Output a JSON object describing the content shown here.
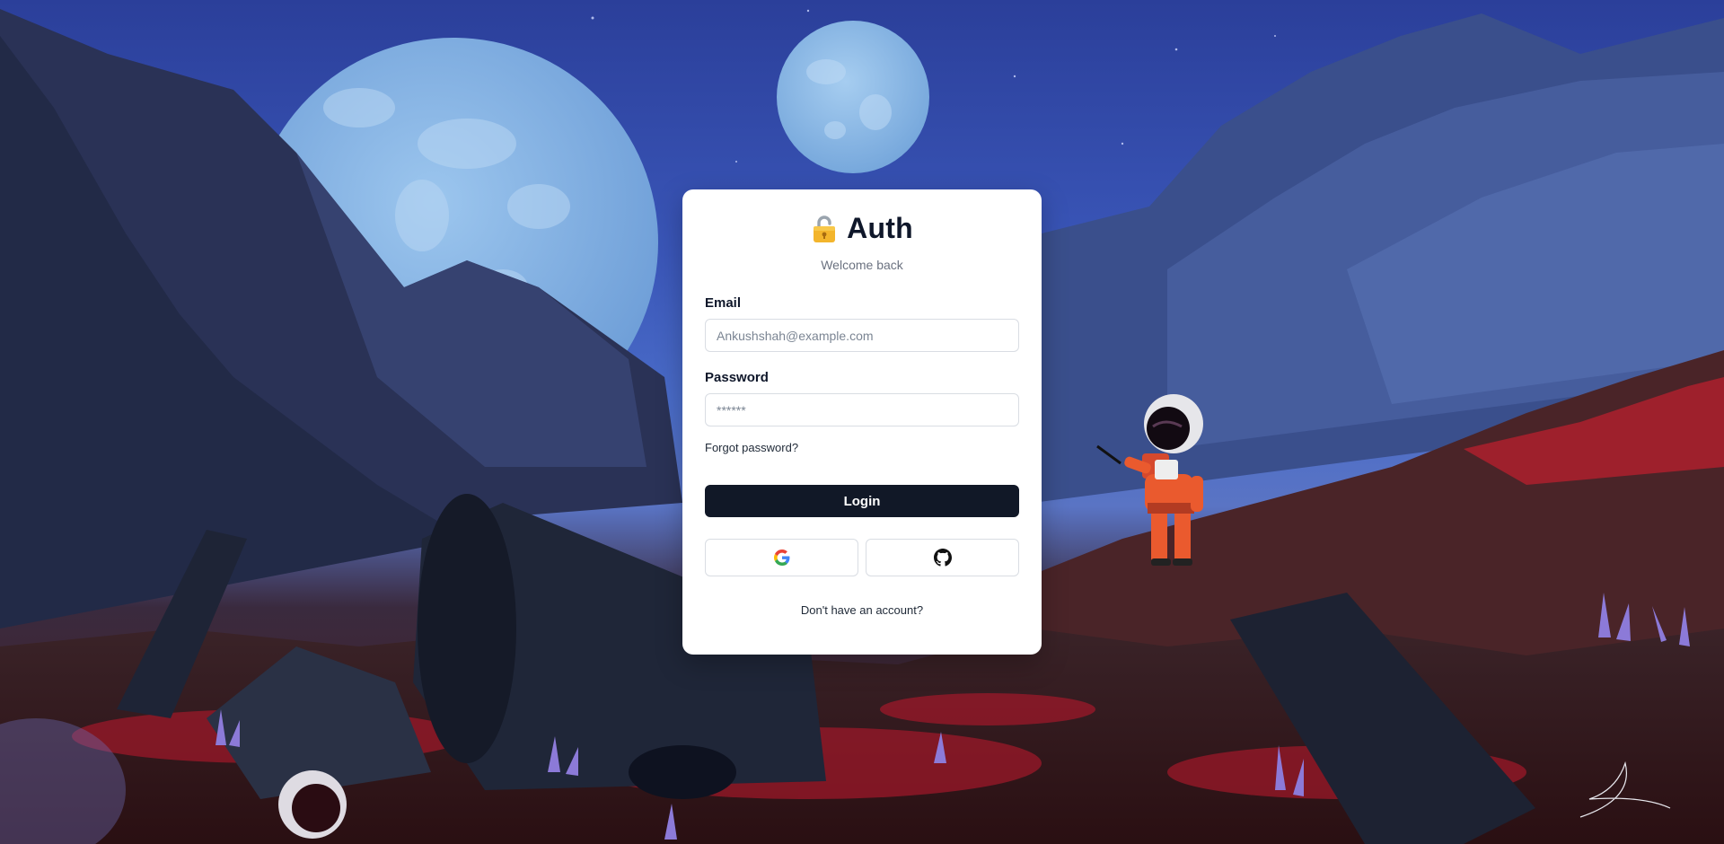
{
  "brand": {
    "icon": "lock-icon",
    "title": "Auth"
  },
  "subtitle": "Welcome back",
  "form": {
    "email_label": "Email",
    "email_placeholder": "Ankushshah@example.com",
    "email_value": "",
    "password_label": "Password",
    "password_placeholder": "******",
    "password_value": "",
    "forgot_label": "Forgot password?",
    "login_label": "Login"
  },
  "social": [
    {
      "provider": "google",
      "icon": "google-icon"
    },
    {
      "provider": "github",
      "icon": "github-icon"
    }
  ],
  "signup_label": "Don't have an account?",
  "colors": {
    "primary_button": "#111827",
    "card_background": "#ffffff",
    "sky": "#2b3f9a",
    "ground": "#4a1f22"
  }
}
